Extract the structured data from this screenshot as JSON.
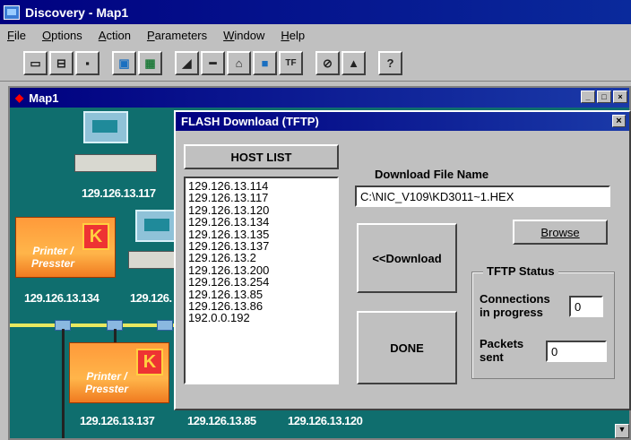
{
  "app": {
    "title": "Discovery - Map1"
  },
  "menu": [
    "File",
    "Options",
    "Action",
    "Parameters",
    "Window",
    "Help"
  ],
  "toolbar_icons": [
    "new-doc-icon",
    "open-icon",
    "save-icon",
    "map-view-icon",
    "network-icon",
    "signal-icon",
    "minus-icon",
    "home-icon",
    "monitor-icon",
    "tftp-icon",
    "stop-icon",
    "alert-icon",
    "help-icon"
  ],
  "map": {
    "title": "Map1",
    "ips": {
      "top": "129.126.13.117",
      "printer1": "129.126.13.134",
      "partial": "129.126.",
      "printer2": "129.126.13.137",
      "bottom_mid": "129.126.13.85",
      "bottom_right": "129.126.13.120"
    },
    "printer_label": "Printer / Presster",
    "printer2_label": "Printer / Presster"
  },
  "dialog": {
    "title": "FLASH Download (TFTP)",
    "host_list_button": "HOST LIST",
    "hosts": [
      "129.126.13.114",
      "129.126.13.117",
      "129.126.13.120",
      "129.126.13.134",
      "129.126.13.135",
      "129.126.13.137",
      "129.126.13.2",
      "129.126.13.200",
      "129.126.13.254",
      "129.126.13.85",
      "129.126.13.86",
      "192.0.0.192"
    ],
    "download_file_label": "Download File Name",
    "download_file_value": "C:\\NIC_V109\\KD3011~1.HEX",
    "browse_button": "Browse",
    "download_button": "<<Download",
    "done_button": "DONE",
    "tftp_status": {
      "title": "TFTP Status",
      "connections_label_1": "Connections",
      "connections_label_2": "in progress",
      "connections_value": "0",
      "packets_label_1": "Packets",
      "packets_label_2": "sent",
      "packets_value": "0"
    }
  },
  "colors": {
    "titlebar": "#000080",
    "map_bg": "#0f6e6e",
    "window_bg": "#c0c0c0"
  }
}
